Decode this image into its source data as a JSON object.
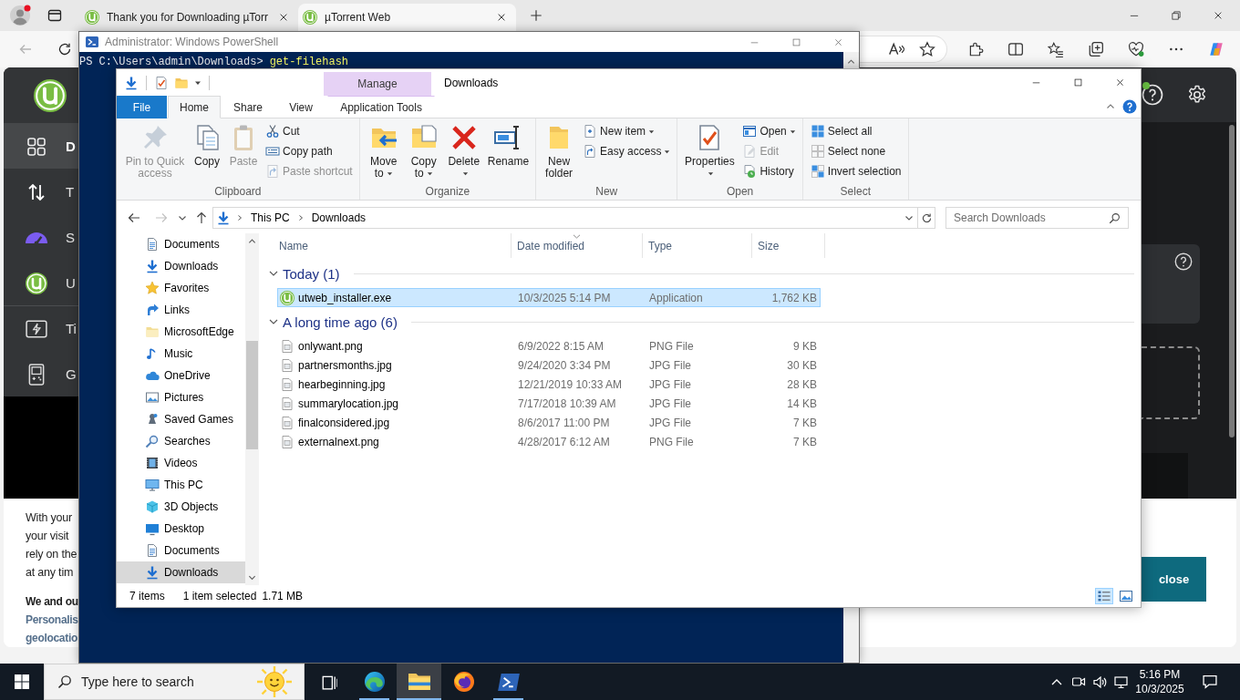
{
  "browser": {
    "tabs": [
      {
        "title": "Thank you for Downloading µTorr",
        "selected": false
      },
      {
        "title": "µTorrent Web",
        "selected": true
      }
    ],
    "page": {
      "sidebar": [
        {
          "label": "D",
          "selected": true
        },
        {
          "label": "T",
          "selected": false
        },
        {
          "label": "S",
          "selected": false
        },
        {
          "label": "U",
          "selected": false
        },
        {
          "label": "Ti",
          "selected": false
        },
        {
          "label": "G",
          "selected": false
        }
      ],
      "top_bar": {
        "help_badge": true
      },
      "cookie_banner": {
        "lines": [
          "With your",
          "your visit",
          "rely on the",
          "at any tim"
        ],
        "heading": "We and ou",
        "purposes": [
          "Personalis",
          "geolocatio"
        ],
        "button": "close"
      }
    }
  },
  "powershell": {
    "title": "Administrator: Windows PowerShell",
    "lines": [
      {
        "prompt": "PS C:\\Users\\admin\\Downloads>",
        "command": "get-filehash"
      }
    ]
  },
  "explorer": {
    "title": "Downloads",
    "context_group": "Manage",
    "tabs": [
      {
        "label": "File",
        "kind": "file",
        "selected": false
      },
      {
        "label": "Home",
        "kind": "standard",
        "selected": true
      },
      {
        "label": "Share",
        "kind": "standard",
        "selected": false
      },
      {
        "label": "View",
        "kind": "standard",
        "selected": false
      },
      {
        "label": "Application Tools",
        "kind": "contextual",
        "selected": false
      }
    ],
    "ribbon": [
      {
        "label": "Clipboard",
        "buttons": [
          {
            "label": "Pin to Quick access",
            "kind": "large",
            "dropdown": false,
            "disabled": true
          },
          {
            "label": "Copy",
            "kind": "large",
            "dropdown": false,
            "disabled": false
          },
          {
            "label": "Paste",
            "kind": "large",
            "dropdown": false,
            "disabled": true
          },
          {
            "label": "Cut",
            "kind": "small",
            "dropdown": false,
            "disabled": false
          },
          {
            "label": "Copy path",
            "kind": "small",
            "dropdown": false,
            "disabled": false
          },
          {
            "label": "Paste shortcut",
            "kind": "small",
            "dropdown": false,
            "disabled": true
          }
        ]
      },
      {
        "label": "Organize",
        "buttons": [
          {
            "label": "Move to",
            "kind": "large",
            "dropdown": true,
            "disabled": false
          },
          {
            "label": "Copy to",
            "kind": "large",
            "dropdown": true,
            "disabled": false
          },
          {
            "label": "Delete",
            "kind": "large",
            "dropdown": true,
            "disabled": false
          },
          {
            "label": "Rename",
            "kind": "large",
            "dropdown": false,
            "disabled": false
          }
        ]
      },
      {
        "label": "New",
        "buttons": [
          {
            "label": "New folder",
            "kind": "large",
            "dropdown": false,
            "disabled": false
          },
          {
            "label": "New item",
            "kind": "small",
            "dropdown": true,
            "disabled": false
          },
          {
            "label": "Easy access",
            "kind": "small",
            "dropdown": true,
            "disabled": false
          }
        ]
      },
      {
        "label": "Open",
        "buttons": [
          {
            "label": "Properties",
            "kind": "large",
            "dropdown": true,
            "disabled": false
          },
          {
            "label": "Open",
            "kind": "small",
            "dropdown": true,
            "disabled": false
          },
          {
            "label": "Edit",
            "kind": "small",
            "dropdown": false,
            "disabled": true
          },
          {
            "label": "History",
            "kind": "small",
            "dropdown": false,
            "disabled": false
          }
        ]
      },
      {
        "label": "Select",
        "buttons": [
          {
            "label": "Select all",
            "kind": "small",
            "dropdown": false,
            "disabled": false
          },
          {
            "label": "Select none",
            "kind": "small",
            "dropdown": false,
            "disabled": false
          },
          {
            "label": "Invert selection",
            "kind": "small",
            "dropdown": false,
            "disabled": false
          }
        ]
      }
    ],
    "address": {
      "path": [
        "This PC",
        "Downloads"
      ]
    },
    "search": {
      "placeholder": "Search Downloads"
    },
    "nav_pane": [
      {
        "children": [
          {
            "label": "Documents",
            "selected": false
          },
          {
            "label": "Downloads",
            "selected": false
          },
          {
            "label": "Favorites",
            "selected": false
          },
          {
            "label": "Links",
            "selected": false
          },
          {
            "label": "MicrosoftEdge",
            "selected": false
          },
          {
            "label": "Music",
            "selected": false
          },
          {
            "label": "OneDrive",
            "selected": false
          },
          {
            "label": "Pictures",
            "selected": false
          },
          {
            "label": "Saved Games",
            "selected": false
          },
          {
            "label": "Searches",
            "selected": false
          },
          {
            "label": "Videos",
            "selected": false
          }
        ]
      },
      {
        "label": "This PC",
        "selected": false,
        "children": [
          {
            "label": "3D Objects",
            "selected": false
          },
          {
            "label": "Desktop",
            "selected": false
          },
          {
            "label": "Documents",
            "selected": false
          },
          {
            "label": "Downloads",
            "selected": true
          }
        ]
      }
    ],
    "columns": [
      {
        "label": "Name",
        "sorted": false
      },
      {
        "label": "Date modified",
        "sorted": true
      },
      {
        "label": "Type",
        "sorted": false
      },
      {
        "label": "Size",
        "sorted": false
      }
    ],
    "groups": [
      {
        "label": "Today (1)",
        "expanded": true,
        "files": [
          {
            "name": "utweb_installer.exe",
            "date": "10/3/2025 5:14 PM",
            "type": "Application",
            "size": "1,762 KB",
            "kind": "application",
            "selected": true
          }
        ]
      },
      {
        "label": "A long time ago (6)",
        "expanded": true,
        "files": [
          {
            "name": "onlywant.png",
            "date": "6/9/2022 8:15 AM",
            "type": "PNG File",
            "size": "9 KB",
            "kind": "image",
            "selected": false
          },
          {
            "name": "partnersmonths.jpg",
            "date": "9/24/2020 3:34 PM",
            "type": "JPG File",
            "size": "30 KB",
            "kind": "image",
            "selected": false
          },
          {
            "name": "hearbeginning.jpg",
            "date": "12/21/2019 10:33 AM",
            "type": "JPG File",
            "size": "28 KB",
            "kind": "image",
            "selected": false
          },
          {
            "name": "summarylocation.jpg",
            "date": "7/17/2018 10:39 AM",
            "type": "JPG File",
            "size": "14 KB",
            "kind": "image",
            "selected": false
          },
          {
            "name": "finalconsidered.jpg",
            "date": "8/6/2017 11:00 PM",
            "type": "JPG File",
            "size": "7 KB",
            "kind": "image",
            "selected": false
          },
          {
            "name": "externalnext.png",
            "date": "4/28/2017 6:12 AM",
            "type": "PNG File",
            "size": "7 KB",
            "kind": "image",
            "selected": false
          }
        ]
      }
    ],
    "status": {
      "count": "7 items",
      "selection": "1 item selected",
      "size": "1.71 MB",
      "views": [
        {
          "selected": true
        },
        {
          "selected": false
        }
      ]
    }
  },
  "taskbar": {
    "search": {
      "placeholder": "Type here to search"
    },
    "apps": [
      {
        "running": true,
        "active": false
      },
      {
        "running": true,
        "active": true
      },
      {
        "running": false,
        "active": false
      },
      {
        "running": true,
        "active": false
      }
    ],
    "clock": {
      "time": "5:16 PM",
      "date": "10/3/2025"
    }
  }
}
